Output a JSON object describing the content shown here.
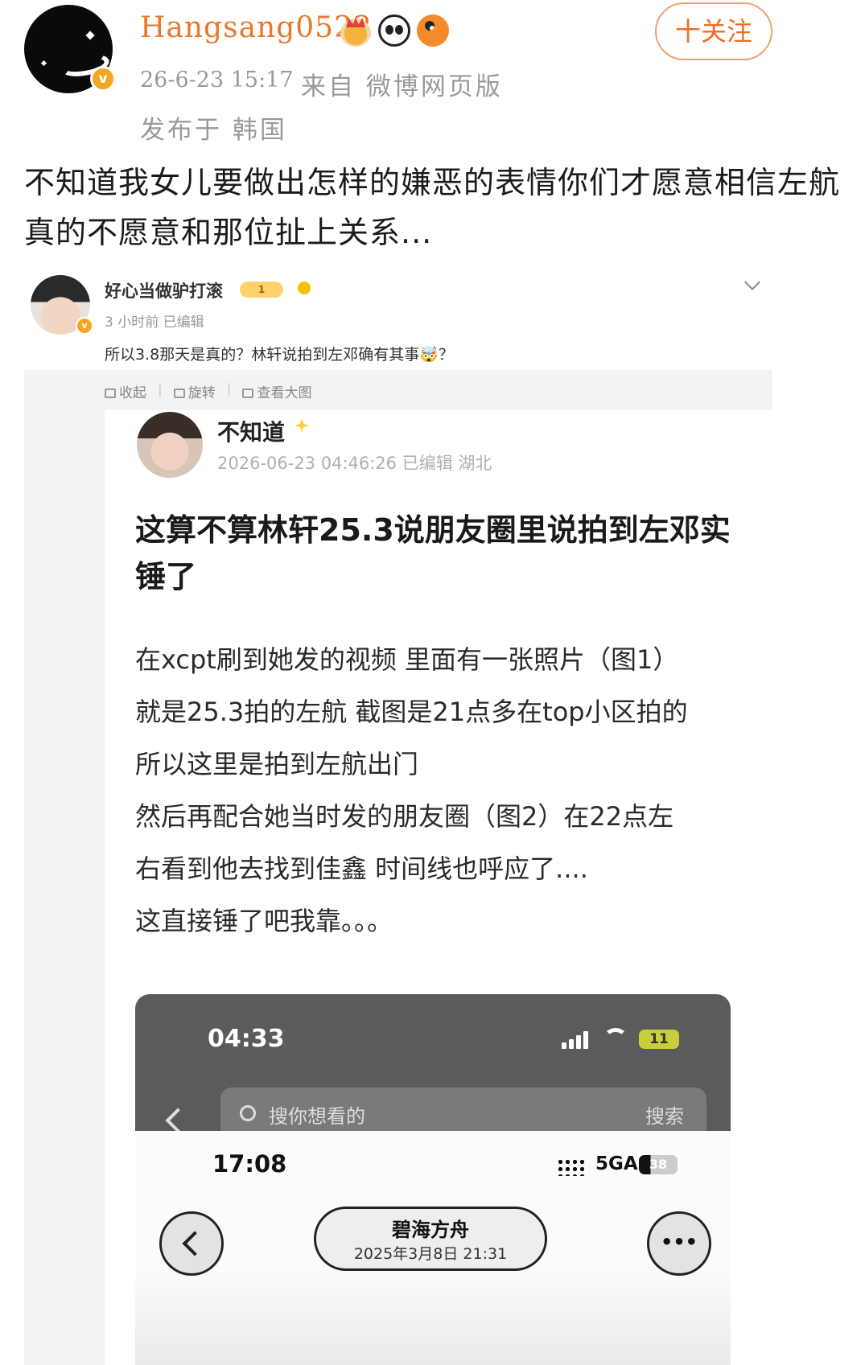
{
  "post": {
    "username": "Hangsang0522",
    "verified_mark": "v",
    "follow_label": "十关注",
    "time": "26-6-23 15:17",
    "source": "来自 微博网页版",
    "location": "发布于 韩国",
    "text": "不知道我女儿要做出怎样的嫌恶的表情你们才愿意相信左航真的不愿意和那位扯上关系...",
    "badges": [
      "crown-icon",
      "panda-icon",
      "fish-icon"
    ],
    "accent_color": "#e8782a"
  },
  "embed": {
    "username": "好心当做驴打滚",
    "level": "1",
    "verified_mark": "v",
    "meta": "3 小时前   已编辑",
    "text": "所以3.8那天是真的？林轩说拍到左邓确有其事🤯？",
    "actions": [
      "收起",
      "旋转",
      "查看大图"
    ],
    "inner": {
      "username": "不知道",
      "meta": "2026-06-23 04:46:26 已编辑 湖北",
      "title": "这算不算林轩25.3说朋友圈里说拍到左邓实锤了",
      "lines": [
        "在xcpt刷到她发的视频 里面有一张照片（图1）",
        "就是25.3拍的左航 截图是21点多在top小区拍的",
        "所以这里是拍到左航出门",
        "然后再配合她当时发的朋友圈（图2）在22点左",
        "右看到他去找到佳鑫 时间线也呼应了....",
        "这直接锤了吧我靠。。。"
      ],
      "phone": {
        "time1": "04:33",
        "battery1": "11",
        "search_placeholder": "搜你想看的",
        "search_button": "搜索",
        "time2": "17:08",
        "network": "5GA",
        "battery2": "38",
        "location_name": "碧海方舟",
        "location_date": "2025年3月8日 21:31",
        "more": "•••"
      }
    }
  }
}
